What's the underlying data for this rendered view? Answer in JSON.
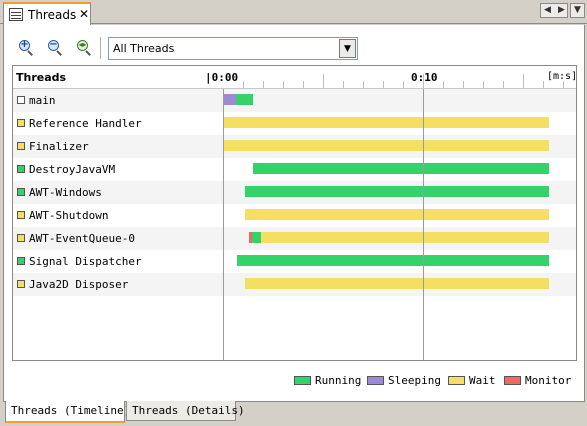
{
  "tab": {
    "label": "Threads",
    "close": "✕"
  },
  "nav": {
    "prev": "◀",
    "next": "▶",
    "dropdown": "▼"
  },
  "toolbar": {
    "zoom_in_sign": "+",
    "zoom_out_sign": "−",
    "filter": {
      "value": "All Threads",
      "arrow": "▼"
    }
  },
  "timeline": {
    "column_title": "Threads",
    "time_start": "|0:00",
    "time_mid": "0:10",
    "unit": "[m:s]",
    "states": {
      "running": "#34d36a",
      "sleeping": "#9b8ad6",
      "wait": "#f5df63",
      "monitor": "#e96b62"
    },
    "max_time_s": 16.3,
    "threads": [
      {
        "name": "main",
        "color": "#ffffff",
        "segments": [
          {
            "state": "sleeping",
            "start": 0.0,
            "end": 0.65
          },
          {
            "state": "running",
            "start": 0.65,
            "end": 1.5
          }
        ]
      },
      {
        "name": "Reference Handler",
        "color": "#f5df63",
        "segments": [
          {
            "state": "wait",
            "start": 0.0,
            "end": 16.3
          }
        ]
      },
      {
        "name": "Finalizer",
        "color": "#f5df63",
        "segments": [
          {
            "state": "wait",
            "start": 0.0,
            "end": 16.3
          }
        ]
      },
      {
        "name": "DestroyJavaVM",
        "color": "#34d36a",
        "segments": [
          {
            "state": "running",
            "start": 1.5,
            "end": 16.3
          }
        ]
      },
      {
        "name": "AWT-Windows",
        "color": "#34d36a",
        "segments": [
          {
            "state": "running",
            "start": 1.1,
            "end": 16.3
          }
        ]
      },
      {
        "name": "AWT-Shutdown",
        "color": "#f5df63",
        "segments": [
          {
            "state": "wait",
            "start": 1.1,
            "end": 16.3
          }
        ]
      },
      {
        "name": "AWT-EventQueue-0",
        "color": "#f5df63",
        "segments": [
          {
            "state": "monitor",
            "start": 1.3,
            "end": 1.45
          },
          {
            "state": "running",
            "start": 1.45,
            "end": 1.9
          },
          {
            "state": "wait",
            "start": 1.9,
            "end": 16.3
          }
        ]
      },
      {
        "name": "Signal Dispatcher",
        "color": "#34d36a",
        "segments": [
          {
            "state": "running",
            "start": 0.7,
            "end": 16.3
          }
        ]
      },
      {
        "name": "Java2D Disposer",
        "color": "#f5df63",
        "segments": [
          {
            "state": "wait",
            "start": 1.1,
            "end": 16.3
          }
        ]
      }
    ]
  },
  "legend": [
    {
      "key": "running",
      "label": "Running"
    },
    {
      "key": "sleeping",
      "label": "Sleeping"
    },
    {
      "key": "wait",
      "label": "Wait"
    },
    {
      "key": "monitor",
      "label": "Monitor"
    }
  ],
  "bottom_tabs": {
    "timeline": "Threads (Timeline)",
    "details": "Threads (Details)"
  }
}
